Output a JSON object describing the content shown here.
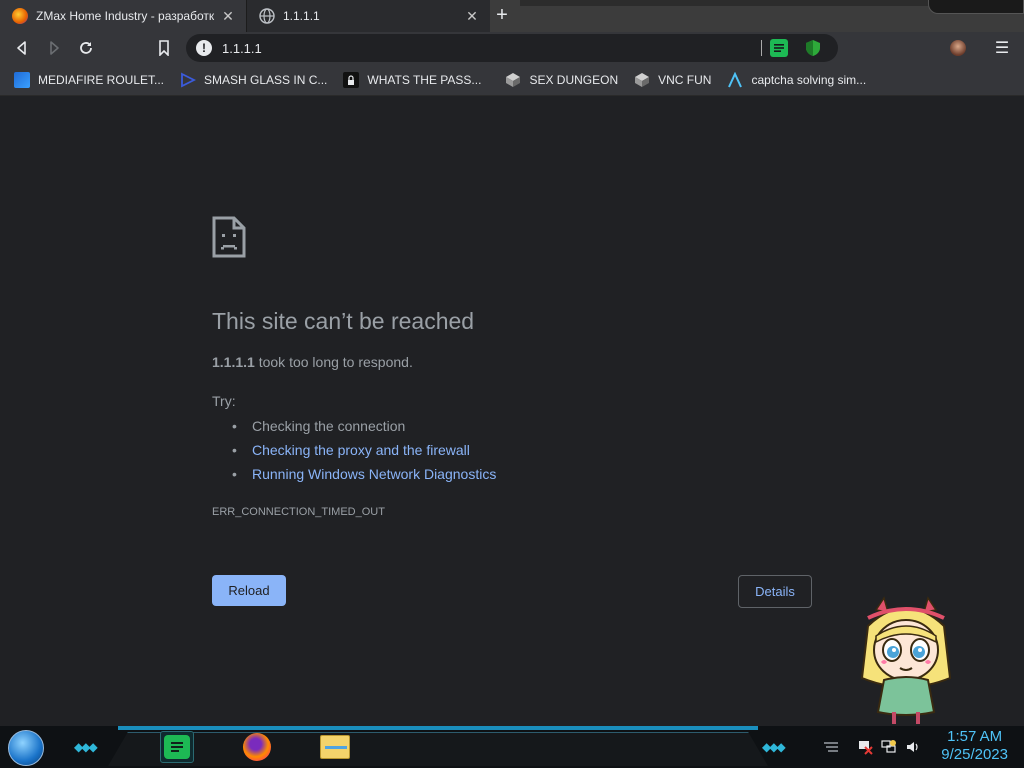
{
  "tabs": [
    {
      "title": "ZMax Home Industry - разработк",
      "active": true,
      "favicon": "firefox-like-icon"
    },
    {
      "title": "1.1.1.1",
      "active": false,
      "favicon": "globe-icon"
    }
  ],
  "toolbar": {
    "url": "1.1.1.1",
    "back_icon": "back-arrow-icon",
    "forward_icon": "forward-arrow-icon",
    "reload_icon": "reload-icon"
  },
  "bookmarks": [
    {
      "label": "MEDIAFIRE ROULET...",
      "icon": "mediafire-icon"
    },
    {
      "label": "SMASH GLASS IN C...",
      "icon": "smash-icon"
    },
    {
      "label": "WHATS THE PASS...",
      "icon": "lock-icon"
    },
    {
      "label": "SEX DUNGEON",
      "icon": "cube-icon"
    },
    {
      "label": "VNC FUN",
      "icon": "cube-icon"
    },
    {
      "label": "captcha solving sim...",
      "icon": "lambda-icon"
    }
  ],
  "error": {
    "headline": "This site can’t be reached",
    "host": "1.1.1.1",
    "message": " took too long to respond.",
    "try_label": "Try:",
    "suggestions": [
      {
        "text": "Checking the connection",
        "link": false
      },
      {
        "text": "Checking the proxy and the firewall",
        "link": true
      },
      {
        "text": "Running Windows Network Diagnostics",
        "link": true
      }
    ],
    "code": "ERR_CONNECTION_TIMED_OUT",
    "reload_label": "Reload",
    "details_label": "Details"
  },
  "taskbar": {
    "time": "1:57 AM",
    "date": "9/25/2023"
  },
  "colors": {
    "background": "#202124",
    "link": "#8ab4f8",
    "text": "#9aa0a6",
    "clock": "#4fc3f7"
  }
}
